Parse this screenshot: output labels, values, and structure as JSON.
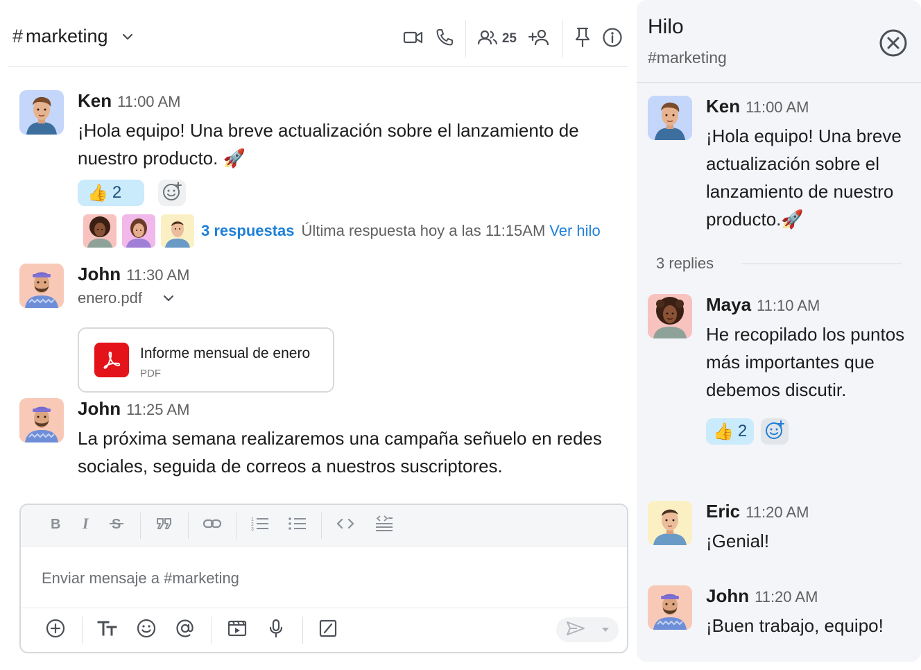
{
  "channel": {
    "hash": "#",
    "name": "marketing",
    "member_count": "25"
  },
  "messages": [
    {
      "author": "Ken",
      "time": "11:00 AM",
      "text": "¡Hola equipo! Una breve actualización sobre el lanzamiento de nuestro producto. 🚀",
      "reaction_emoji": "👍",
      "reaction_count": "2",
      "thread_count": "3 respuestas",
      "thread_last": "Última respuesta hoy a las 11:15AM",
      "thread_link": "Ver hilo"
    },
    {
      "author": "John",
      "time": "11:30 AM",
      "file_name": "enero.pdf",
      "file_title": "Informe mensual de enero",
      "file_type": "PDF"
    },
    {
      "author": "John",
      "time": "11:25 AM",
      "text": "La próxima semana realizaremos una campaña señuelo en redes sociales, seguida de correos a nuestros suscriptores."
    }
  ],
  "composer": {
    "placeholder": "Enviar mensaje a #marketing",
    "format_buttons": [
      "bold-icon",
      "italic-icon",
      "strikethrough-icon",
      "quote-icon",
      "link-icon",
      "ordered-list-icon",
      "bullet-list-icon",
      "code-icon",
      "code-block-icon"
    ],
    "tool_buttons": [
      "plus-circle-icon",
      "text-format-icon",
      "emoji-icon",
      "mention-icon",
      "video-clip-icon",
      "microphone-icon",
      "slash-command-icon"
    ]
  },
  "thread": {
    "title": "Hilo",
    "subtitle": "#marketing",
    "root": {
      "author": "Ken",
      "time": "11:00 AM",
      "text": "¡Hola equipo! Una breve actualización sobre el lanzamiento de nuestro producto.🚀"
    },
    "replies_label": "3 replies",
    "replies": [
      {
        "author": "Maya",
        "time": "11:10 AM",
        "text": "He recopilado los puntos más importantes que debemos discutir.",
        "reaction_emoji": "👍",
        "reaction_count": "2"
      },
      {
        "author": "Eric",
        "time": "11:20 AM",
        "text": "¡Genial!"
      },
      {
        "author": "John",
        "time": "11:20 AM",
        "text": "¡Buen trabajo, equipo!"
      }
    ]
  },
  "colors": {
    "accent": "#1d7fd8",
    "reaction_bg": "#c9ebfb",
    "pdf_red": "#e4131a",
    "thread_bg": "#f3f5f8"
  }
}
